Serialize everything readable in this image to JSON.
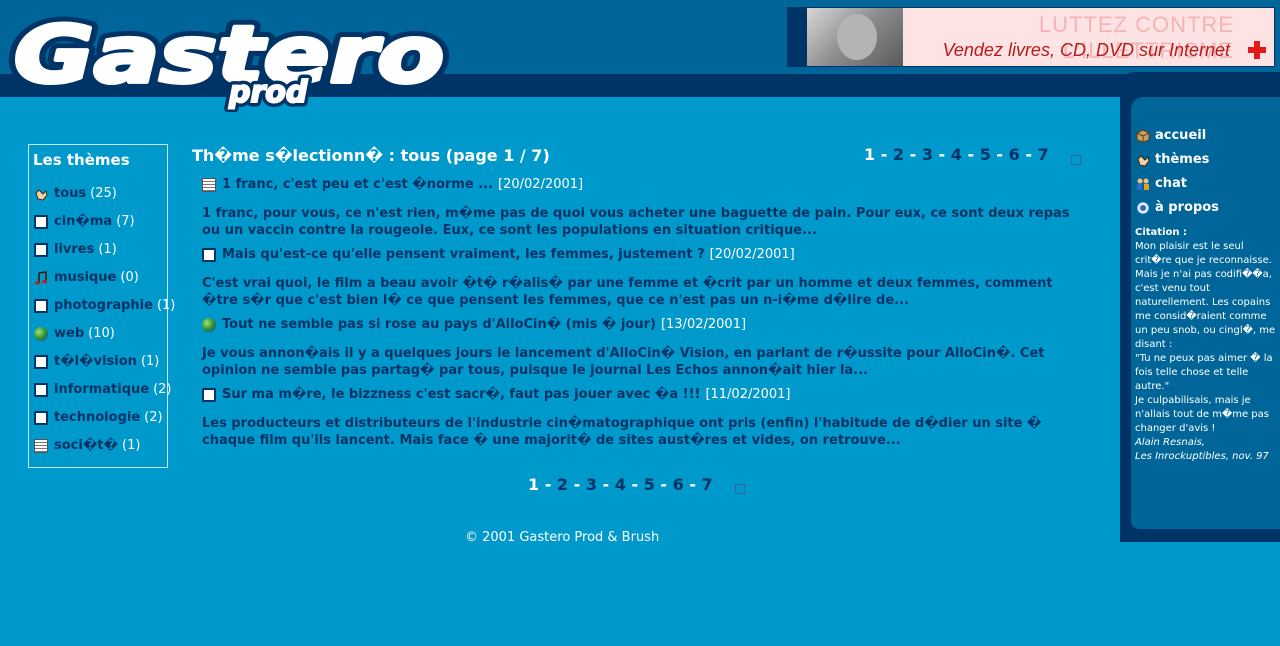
{
  "brand": {
    "logo_text": "Gastero",
    "logo_sub": "prod"
  },
  "banner": {
    "line1": "LUTTEZ CONTRE L'ILLETTRISME",
    "line2": "Vendez livres, CD, DVD sur Internet"
  },
  "nav": {
    "items": [
      {
        "label": "accueil",
        "icon": "box-icon"
      },
      {
        "label": "thèmes",
        "icon": "hand-icon"
      },
      {
        "label": "chat",
        "icon": "people-icon"
      },
      {
        "label": "à propos",
        "icon": "info-icon"
      }
    ]
  },
  "quote": {
    "title": "Citation :",
    "text1": "Mon plaisir est le seul crit�re que je reconnaisse. Mais je n'ai pas codifi��a, c'est venu tout naturellement. Les copains me consid�raient comme un peu snob, ou cingl�, me disant :",
    "text2": "\"Tu ne peux pas aimer � la fois telle chose et telle autre.\"",
    "text3": "Je culpabilisais, mais je n'allais tout de m�me pas changer d'avis !",
    "author": "Alain Resnais,",
    "source": "Les Inrockuptibles, nov. 97"
  },
  "themes": {
    "title": "Les thèmes",
    "items": [
      {
        "label": "tous",
        "count": "(25)",
        "icon": "hand-icon"
      },
      {
        "label": "cin�ma",
        "count": "(7)",
        "icon": "square-icon"
      },
      {
        "label": "livres",
        "count": "(1)",
        "icon": "square-icon"
      },
      {
        "label": "musique",
        "count": "(0)",
        "icon": "music-note-icon"
      },
      {
        "label": "photographie",
        "count": "(1)",
        "icon": "square-icon"
      },
      {
        "label": "web",
        "count": "(10)",
        "icon": "globe-icon"
      },
      {
        "label": "t�l�vision",
        "count": "(1)",
        "icon": "square-icon"
      },
      {
        "label": "informatique",
        "count": "(2)",
        "icon": "square-icon"
      },
      {
        "label": "technologie",
        "count": "(2)",
        "icon": "square-icon"
      },
      {
        "label": "soci�t�",
        "count": "(1)",
        "icon": "newspaper-icon"
      }
    ]
  },
  "main": {
    "title": "Th�me s�lectionn� : tous (page 1 / 7)",
    "pages": [
      "1",
      "2",
      "3",
      "4",
      "5",
      "6",
      "7"
    ],
    "current_page": "1",
    "articles": [
      {
        "title": "1 franc, c'est peu et c'est �norme ...",
        "date": "[20/02/2001]",
        "icon": "newspaper-icon",
        "body": "1 franc, pour vous, ce n'est rien, m�me pas de quoi vous acheter une baguette de pain. Pour eux, ce sont deux repas ou un vaccin contre la rougeole. Eux, ce sont les populations en situation critique..."
      },
      {
        "title": "Mais qu'est-ce qu'elle pensent vraiment, les femmes, justement ?",
        "date": "[20/02/2001]",
        "icon": "square-icon",
        "body": "C'est vrai quoi, le film a beau avoir �t� r�alis� par une femme et �crit par un homme et deux femmes, comment �tre s�r que c'est bien l� ce que pensent les femmes, que ce n'est pas un n-i�me d�lire de..."
      },
      {
        "title": "Tout ne semble pas si rose au pays d'AlloCin� (mis � jour)",
        "date": "[13/02/2001]",
        "icon": "globe-icon",
        "body": "Je vous annon�ais il y a quelques jours le lancement d'AlloCin� Vision, en parlant de r�ussite pour AlloCin�. Cet opinion ne semble pas partag� par tous, puisque le journal Les Echos annon�ait hier la..."
      },
      {
        "title": "Sur ma m�re, le bizzness c'est sacr�, faut pas jouer avec �a !!!",
        "date": "[11/02/2001]",
        "icon": "square-icon",
        "body": "Les producteurs et distributeurs de l'industrie cin�matographique ont pris (enfin) l'habitude de d�dier un site � chaque film qu'ils lancent. Mais face � une majorit� de sites aust�res et vides, on retrouve..."
      }
    ]
  },
  "footer": {
    "text": "© 2001 Gastero Prod & Brush"
  },
  "colors": {
    "background": "#0099cc",
    "header": "#006699",
    "dark": "#003366",
    "text_dark": "#003366",
    "text_light": "#ffffff"
  }
}
